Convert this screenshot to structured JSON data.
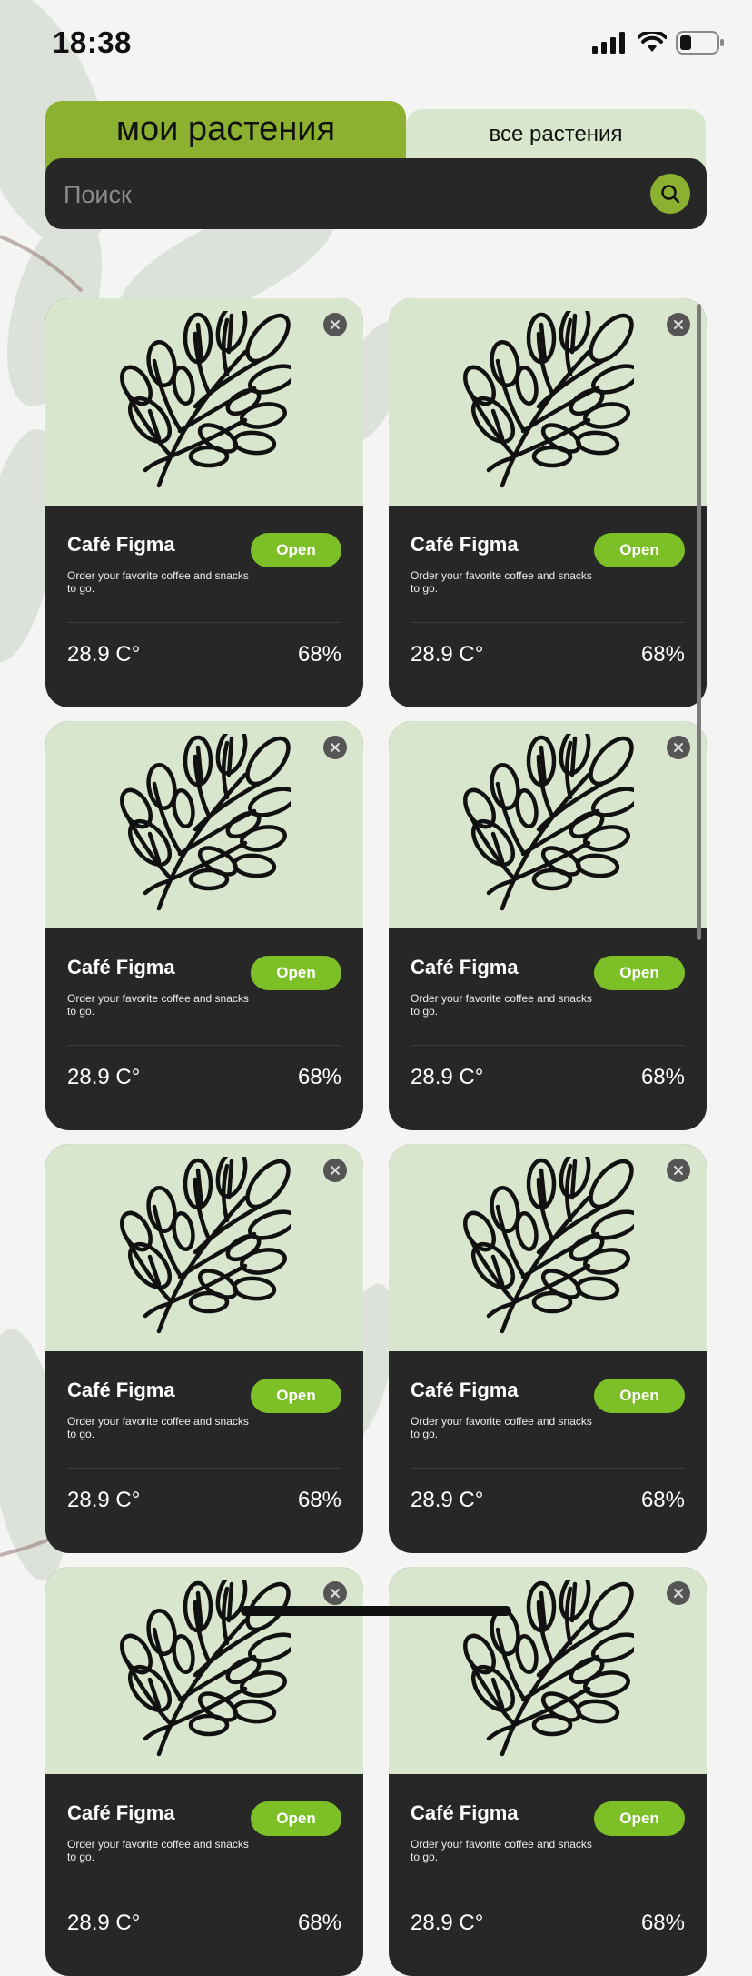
{
  "status": {
    "time": "18:38",
    "icons": [
      "signal-icon",
      "wifi-icon",
      "battery-icon"
    ]
  },
  "tabs": {
    "my_plants": "мои растения",
    "all_plants": "все растения"
  },
  "search": {
    "placeholder": "Поиск",
    "icon": "search-icon"
  },
  "colors": {
    "accent": "#8cb030",
    "open_button": "#7cbf26",
    "card_dark": "#272727",
    "card_image_bg": "#d9e6ce",
    "tab_inactive": "#d8e6cc"
  },
  "cards": [
    {
      "title": "Café Figma",
      "desc": "Order your favorite coffee and snacks to go.",
      "button": "Open",
      "temp": "28.9 C°",
      "humidity": "68%"
    },
    {
      "title": "Café Figma",
      "desc": "Order your favorite coffee and snacks to go.",
      "button": "Open",
      "temp": "28.9 C°",
      "humidity": "68%"
    },
    {
      "title": "Café Figma",
      "desc": "Order your favorite coffee and snacks to go.",
      "button": "Open",
      "temp": "28.9 C°",
      "humidity": "68%"
    },
    {
      "title": "Café Figma",
      "desc": "Order your favorite coffee and snacks to go.",
      "button": "Open",
      "temp": "28.9 C°",
      "humidity": "68%"
    },
    {
      "title": "Café Figma",
      "desc": "Order your favorite coffee and snacks to go.",
      "button": "Open",
      "temp": "28.9 C°",
      "humidity": "68%"
    },
    {
      "title": "Café Figma",
      "desc": "Order your favorite coffee and snacks to go.",
      "button": "Open",
      "temp": "28.9 C°",
      "humidity": "68%"
    },
    {
      "title": "Café Figma",
      "desc": "Order your favorite coffee and snacks to go.",
      "button": "Open",
      "temp": "28.9 C°",
      "humidity": "68%"
    },
    {
      "title": "Café Figma",
      "desc": "Order your favorite coffee and snacks to go.",
      "button": "Open",
      "temp": "28.9 C°",
      "humidity": "68%"
    }
  ]
}
